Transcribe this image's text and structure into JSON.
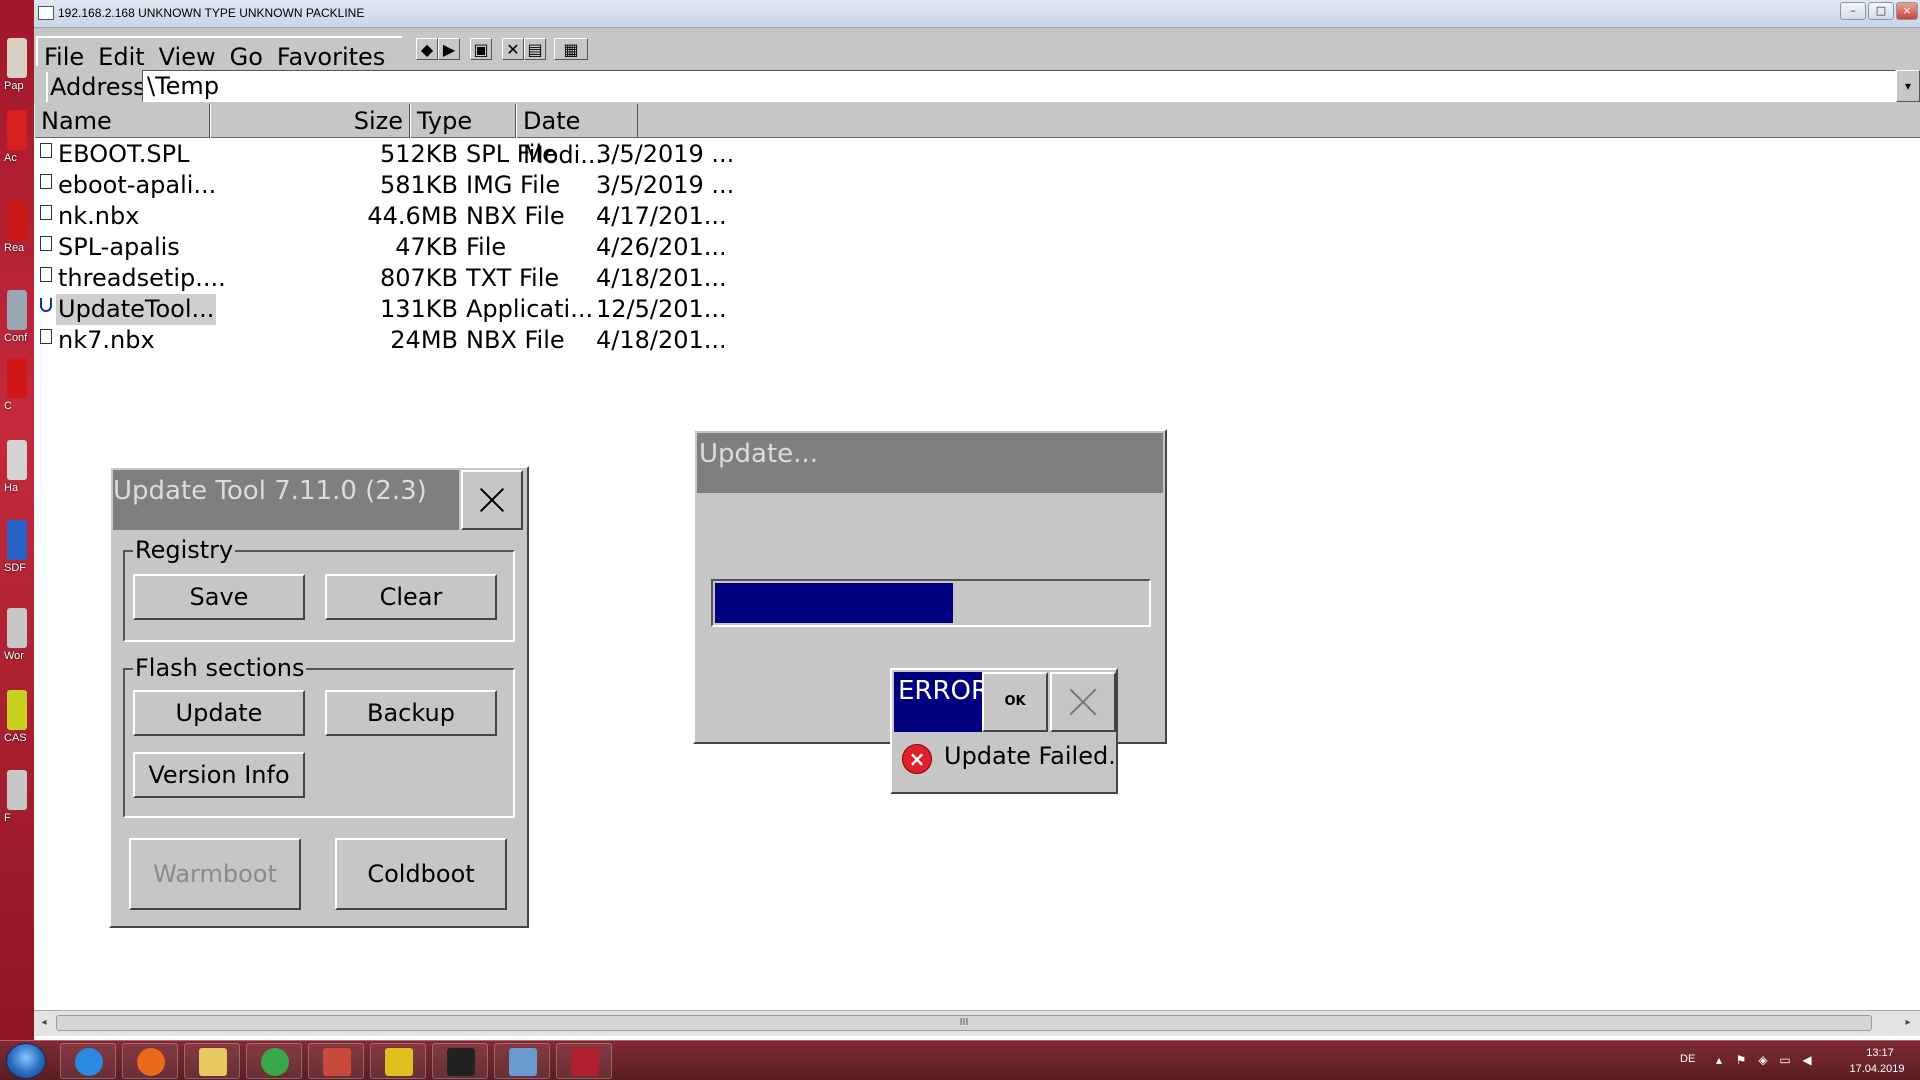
{
  "vnc": {
    "title": "192.168.2.168   UNKNOWN TYPE   UNKNOWN PACKLINE",
    "minimize": "–",
    "maximize": "□",
    "close": "×"
  },
  "desktop_icons": [
    {
      "label": "Pap",
      "color": "#d8d0c0"
    },
    {
      "label": "Ac",
      "color": "#d82020"
    },
    {
      "label": "Rea",
      "color": "#c81818"
    },
    {
      "label": "Conf",
      "color": "#9aa6b4"
    },
    {
      "label": "C",
      "color": "#d01616"
    },
    {
      "label": "Ha",
      "color": "#d4d4d4"
    },
    {
      "label": "SDF",
      "color": "#2a62c8"
    },
    {
      "label": "Wor",
      "color": "#c8c8c8"
    },
    {
      "label": "CAS",
      "color": "#c8d020"
    },
    {
      "label": "F",
      "color": "#c8c8c8"
    }
  ],
  "explorer": {
    "menu": [
      "File",
      "Edit",
      "View",
      "Go",
      "Favorites"
    ],
    "toolbar_icons": [
      "back-arrow-icon",
      "forward-arrow-icon",
      "up-folder-icon",
      "delete-icon",
      "properties-icon",
      "views-icon"
    ],
    "toolbar_glyphs": [
      "◆",
      "▶",
      "▣",
      "✕",
      "▤",
      "▦"
    ],
    "address_label": "Address",
    "address_value": "\\Temp",
    "columns": {
      "name": "Name",
      "size": "Size",
      "type": "Type",
      "date": "Date Modi..."
    },
    "files": [
      {
        "name": "EBOOT.SPL",
        "size": "512KB",
        "type": "SPL File",
        "date": "3/5/2019 ..."
      },
      {
        "name": "eboot-apali...",
        "size": "581KB",
        "type": "IMG File",
        "date": "3/5/2019 ..."
      },
      {
        "name": "nk.nbx",
        "size": "44.6MB",
        "type": "NBX File",
        "date": "4/17/201..."
      },
      {
        "name": "SPL-apalis",
        "size": "47KB",
        "type": "File",
        "date": "4/26/201..."
      },
      {
        "name": "threadsetip....",
        "size": "807KB",
        "type": "TXT File",
        "date": "4/18/201..."
      },
      {
        "name": "UpdateTool...",
        "size": "131KB",
        "type": "Applicati...",
        "date": "12/5/201..."
      },
      {
        "name": "nk7.nbx",
        "size": "24MB",
        "type": "NBX File",
        "date": "4/18/201..."
      }
    ]
  },
  "update_tool": {
    "title": "Update Tool 7.11.0 (2.3)",
    "registry_label": "Registry",
    "save": "Save",
    "clear": "Clear",
    "flash_label": "Flash sections",
    "update": "Update",
    "backup": "Backup",
    "version_info": "Version Info",
    "warmboot": "Warmboot",
    "coldboot": "Coldboot"
  },
  "update_dialog": {
    "title": "Update...",
    "progress_fraction": 0.55
  },
  "error": {
    "title": "ERROR",
    "ok": "OK",
    "message": "Update Failed."
  },
  "scrollbar": {
    "thumb_grip": "III",
    "left": "◂",
    "right": "▸"
  },
  "taskbar": {
    "apps": [
      {
        "name": "ie-icon",
        "color": "#2a8ae0"
      },
      {
        "name": "firefox-icon",
        "color": "#e86a1a"
      },
      {
        "name": "explorer-folder-icon",
        "color": "#e8c860"
      },
      {
        "name": "chrome-icon",
        "color": "#3aa84a"
      },
      {
        "name": "tools-icon",
        "color": "#c84a3a"
      },
      {
        "name": "app-window-icon",
        "color": "#e0c020"
      },
      {
        "name": "cmd-icon",
        "color": "#222222"
      },
      {
        "name": "remote-desktop-icon",
        "color": "#6a9ad0"
      },
      {
        "name": "vnc-icon",
        "color": "#b02030"
      }
    ],
    "lang": "DE",
    "time": "13:17",
    "date": "17.04.2019"
  }
}
